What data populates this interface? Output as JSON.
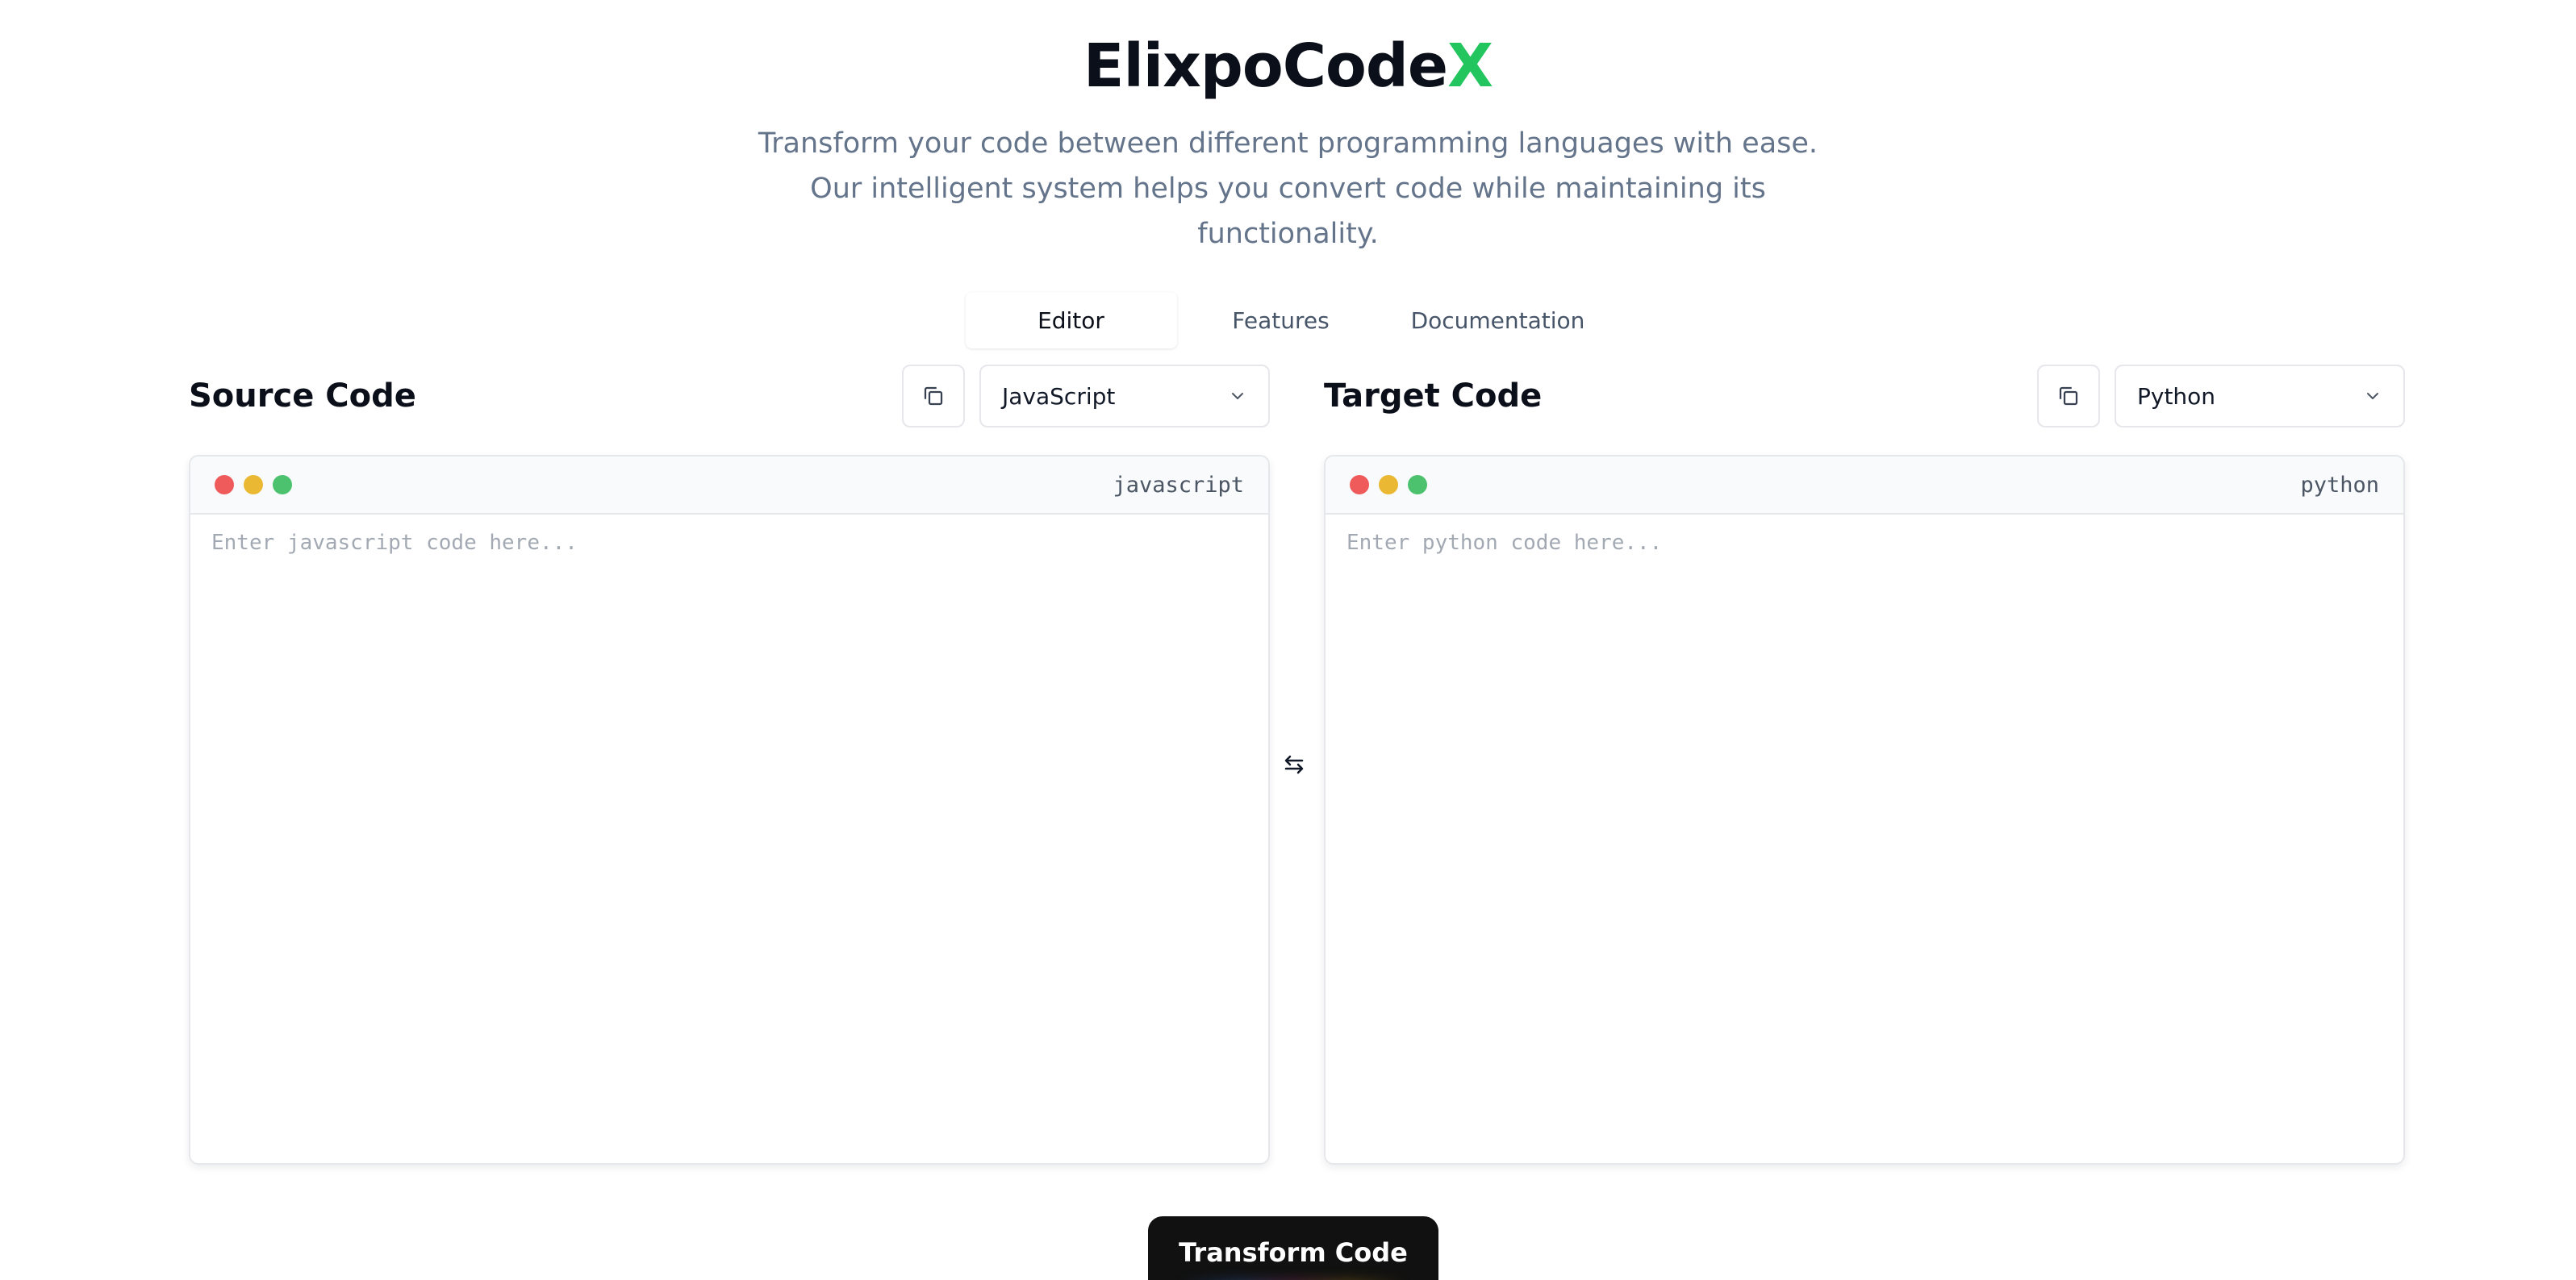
{
  "header": {
    "brand_main": "ElixpoCode",
    "brand_accent": "X",
    "subtitle": "Transform your code between different programming languages with ease. Our intelligent system helps you convert code while maintaining its functionality."
  },
  "tabs": [
    {
      "label": "Editor",
      "active": true
    },
    {
      "label": "Features",
      "active": false
    },
    {
      "label": "Documentation",
      "active": false
    }
  ],
  "source": {
    "title": "Source Code",
    "language": "JavaScript",
    "lang_label": "javascript",
    "placeholder": "Enter javascript code here...",
    "copy_icon": "copy-icon"
  },
  "target": {
    "title": "Target Code",
    "language": "Python",
    "lang_label": "python",
    "placeholder": "Enter python code here...",
    "copy_icon": "copy-icon"
  },
  "swap_icon": "swap-arrows-icon",
  "transform_button": "Transform Code",
  "colors": {
    "accent": "#22c55e",
    "dot_red": "#ef5b5b",
    "dot_yellow": "#eab832",
    "dot_green": "#4cc26e"
  }
}
